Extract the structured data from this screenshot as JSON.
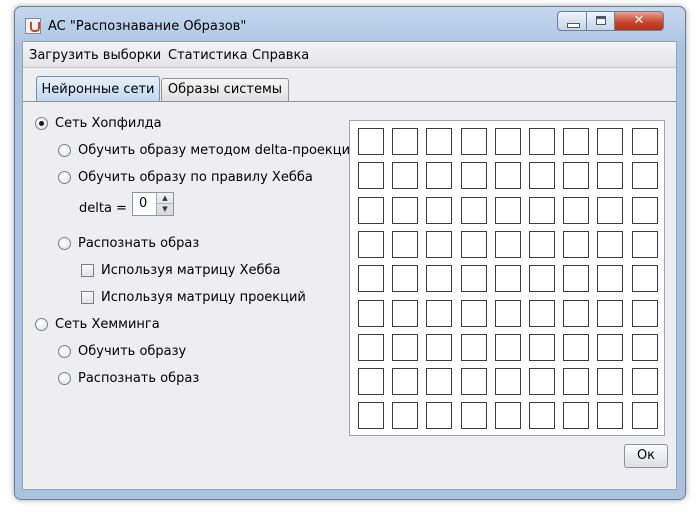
{
  "window": {
    "title": "AC \"Распознавание Образов\"",
    "controls": {
      "minimize": "minimize-icon",
      "maximize": "maximize-icon",
      "close_glyph": "✕"
    }
  },
  "menubar": [
    "Загрузить выборки",
    "Статистика",
    "Справка"
  ],
  "tabs": [
    {
      "label": "Нейронные сети",
      "selected": true
    },
    {
      "label": "Образы системы",
      "selected": false
    }
  ],
  "hopfield": {
    "label": "Сеть Хопфилда",
    "selected": true,
    "train_delta": "Обучить образу методом delta-проекций",
    "train_hebb": "Обучить образу по правилу Хебба",
    "delta_label": "delta =",
    "delta_value": "0",
    "recognize": "Распознать образ",
    "use_hebb_matrix": "Используя матрицу Хебба",
    "use_projection_matrix": "Используя матрицу проекций"
  },
  "hamming": {
    "label": "Сеть Хемминга",
    "selected": false,
    "train": "Обучить образу",
    "recognize": "Распознать образ"
  },
  "grid": {
    "rows": 9,
    "cols": 9
  },
  "ok_button": "Ок",
  "colors": {
    "title_bar": "#b6cde8",
    "client_background": "#eeeef0",
    "close_button": "#c8412a",
    "selected_tab": "#bfd6ef"
  }
}
